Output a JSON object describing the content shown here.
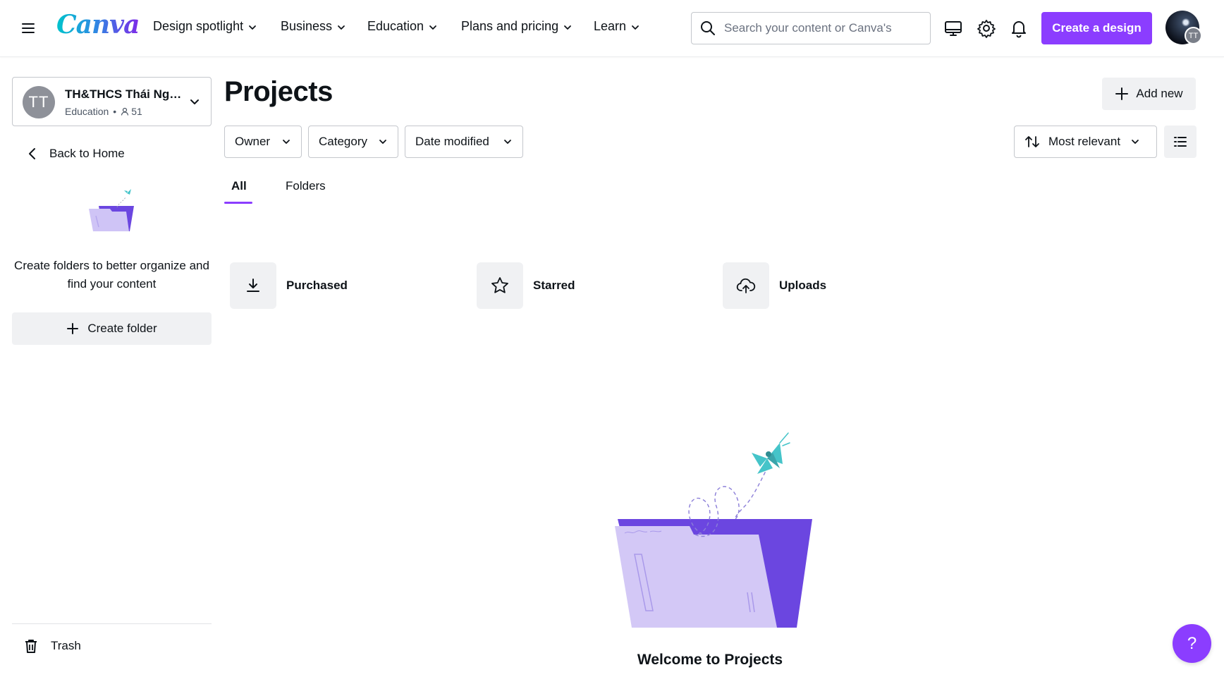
{
  "header": {
    "logo": "Canva",
    "nav": [
      {
        "label": "Design spotlight"
      },
      {
        "label": "Business"
      },
      {
        "label": "Education"
      },
      {
        "label": "Plans and pricing"
      },
      {
        "label": "Learn"
      }
    ],
    "search_placeholder": "Search your content or Canva's",
    "create_label": "Create a design",
    "avatar_initials": "TT",
    "icons": [
      "desktop-icon",
      "gear-icon",
      "bell-icon"
    ],
    "accent_color": "#8b3dff"
  },
  "sidebar": {
    "team_initials": "TT",
    "team_name": "TH&THCS Thái Nguyên",
    "team_type": "Education",
    "team_members": "51",
    "back_label": "Back to Home",
    "promo_text": "Create folders to better organize and find your content",
    "create_folder_label": "Create folder",
    "trash_label": "Trash"
  },
  "main": {
    "title": "Projects",
    "add_new_label": "Add new",
    "filters": [
      {
        "label": "Owner"
      },
      {
        "label": "Category"
      },
      {
        "label": "Date modified"
      }
    ],
    "sort_label": "Most relevant",
    "tabs": [
      {
        "label": "All",
        "active": true
      },
      {
        "label": "Folders",
        "active": false
      }
    ],
    "quick_access": [
      {
        "label": "Purchased",
        "icon": "download-icon"
      },
      {
        "label": "Starred",
        "icon": "star-icon"
      },
      {
        "label": "Uploads",
        "icon": "cloud-upload-icon"
      }
    ],
    "welcome_title": "Welcome to Projects",
    "help_label": "?"
  }
}
